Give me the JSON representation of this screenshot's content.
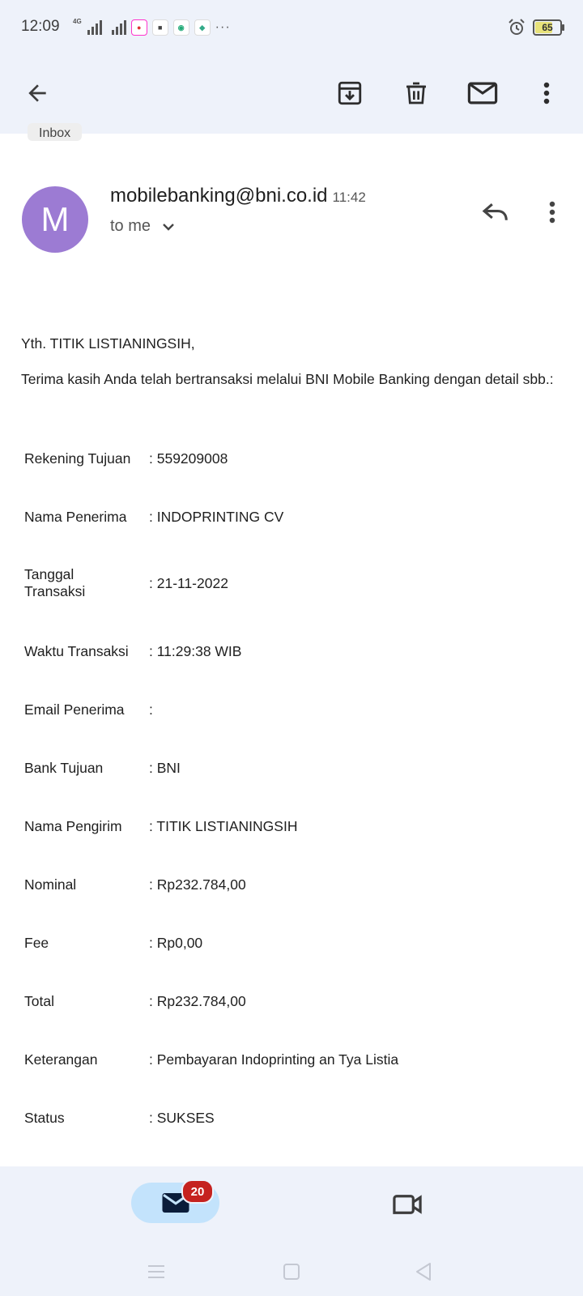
{
  "status_bar": {
    "time": "12:09",
    "network_label": "4G",
    "battery": "65",
    "battery_level": 0.65,
    "app_icons": [
      "app-icon-1",
      "app-icon-2",
      "app-icon-3",
      "app-icon-4"
    ],
    "overflow": "···"
  },
  "toolbar": {
    "back_icon": "arrow-left-icon",
    "archive_icon": "archive-icon",
    "delete_icon": "trash-icon",
    "mark_unread_icon": "mail-icon",
    "more_icon": "more-vert-icon"
  },
  "email": {
    "label_chip": "Inbox",
    "avatar_letter": "M",
    "sender": "mobilebanking@bni.co.id",
    "time": "11:42",
    "recipient": "to me",
    "greeting": "Yth. TITIK LISTIANINGSIH,",
    "intro": "Terima kasih Anda telah bertransaksi melalui BNI Mobile Banking dengan detail sbb.:",
    "details": [
      {
        "label": "Rekening Tujuan",
        "value": ": 559209008"
      },
      {
        "label": "Nama Penerima",
        "value": ": INDOPRINTING CV"
      },
      {
        "label": "Tanggal Transaksi",
        "value": ": 21-11-2022"
      },
      {
        "label": "Waktu Transaksi",
        "value": ": 11:29:38 WIB"
      },
      {
        "label": "Email Penerima",
        "value": ":"
      },
      {
        "label": "Bank Tujuan",
        "value": ": BNI"
      },
      {
        "label": "Nama Pengirim",
        "value": ": TITIK LISTIANINGSIH"
      },
      {
        "label": "Nominal",
        "value": ": Rp232.784,00"
      },
      {
        "label": "Fee",
        "value": ": Rp0,00"
      },
      {
        "label": "Total",
        "value": ": Rp232.784,00"
      },
      {
        "label": "Keterangan",
        "value": ": Pembayaran Indoprinting an Tya Listia"
      },
      {
        "label": "Status",
        "value": ": SUKSES"
      }
    ]
  },
  "bottom_nav": {
    "mail_badge": "20",
    "mail_icon": "mail-filled-icon",
    "meet_icon": "video-camera-icon"
  },
  "colors": {
    "app_bar": "#eef2fa",
    "avatar": "#9c7bd3",
    "badge": "#c5221f",
    "active_pill": "#c3e3fc"
  }
}
